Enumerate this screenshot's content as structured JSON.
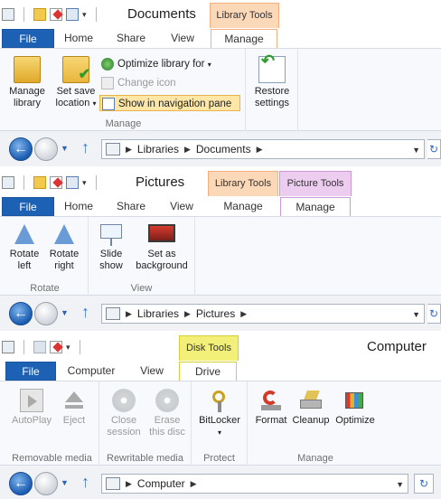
{
  "windows": {
    "documents": {
      "title": "Documents",
      "context_tab_groups": [
        "Library Tools"
      ],
      "tabs": [
        "File",
        "Home",
        "Share",
        "View",
        "Manage"
      ],
      "active_tab": "Manage",
      "groups": {
        "manage": {
          "label": "Manage",
          "manage_library": "Manage library",
          "set_save_location": "Set save location",
          "optimize_library_for": "Optimize library for",
          "change_icon": "Change icon",
          "show_in_navigation_pane": "Show in navigation pane"
        },
        "restore_settings": "Restore settings"
      },
      "address": [
        "Libraries",
        "Documents"
      ]
    },
    "pictures": {
      "title": "Pictures",
      "context_tab_groups": [
        "Library Tools",
        "Picture Tools"
      ],
      "tabs": [
        "File",
        "Home",
        "Share",
        "View",
        "Manage",
        "Manage"
      ],
      "groups": {
        "rotate": {
          "label": "Rotate",
          "rotate_left": "Rotate left",
          "rotate_right": "Rotate right"
        },
        "view": {
          "label": "View",
          "slide_show": "Slide show",
          "set_as_background": "Set as background"
        }
      },
      "address": [
        "Libraries",
        "Pictures"
      ]
    },
    "computer": {
      "title": "Computer",
      "context_tab_groups": [
        "Disk Tools"
      ],
      "tabs": [
        "File",
        "Computer",
        "View",
        "Drive"
      ],
      "active_tab": "Drive",
      "groups": {
        "removable_media": {
          "label": "Removable media",
          "autoplay": "AutoPlay",
          "eject": "Eject"
        },
        "rewritable_media": {
          "label": "Rewritable media",
          "close_session": "Close session",
          "erase_this_disc": "Erase this disc"
        },
        "protect": {
          "label": "Protect",
          "bitlocker": "BitLocker"
        },
        "manage": {
          "label": "Manage",
          "format": "Format",
          "cleanup": "Cleanup",
          "optimize": "Optimize"
        }
      },
      "address": [
        "Computer"
      ]
    }
  },
  "colors": {
    "file_tab": "#1d61b5",
    "library_tools": "#fbd8b8",
    "picture_tools": "#ecccef",
    "disk_tools": "#f3f07a",
    "highlight": "#fde6a6"
  }
}
